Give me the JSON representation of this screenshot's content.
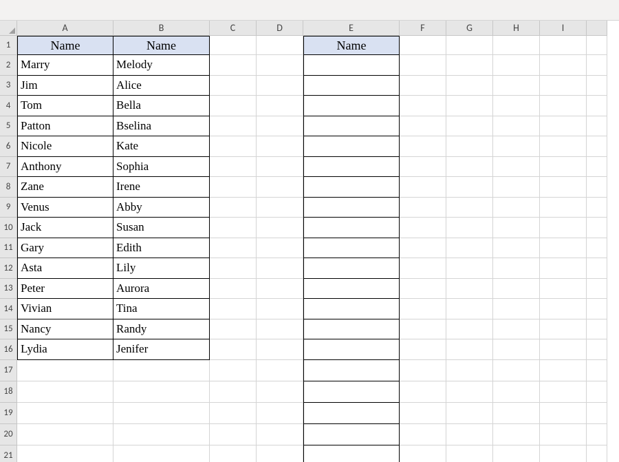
{
  "columns": [
    "A",
    "B",
    "C",
    "D",
    "E",
    "F",
    "G",
    "H",
    "I"
  ],
  "rows": [
    "1",
    "2",
    "3",
    "4",
    "5",
    "6",
    "7",
    "8",
    "9",
    "10",
    "11",
    "12",
    "13",
    "14",
    "15",
    "16",
    "17",
    "18",
    "19",
    "20",
    "21"
  ],
  "headers": {
    "a1": "Name",
    "b1": "Name",
    "e1": "Name"
  },
  "data": {
    "columnA": [
      "Marry",
      "Jim",
      "Tom",
      "Patton",
      "Nicole",
      "Anthony",
      "Zane",
      "Venus",
      "Jack",
      "Gary",
      "Asta",
      "Peter",
      "Vivian",
      "Nancy",
      "Lydia"
    ],
    "columnB": [
      "Melody",
      "Alice",
      "Bella",
      "Bselina",
      "Kate",
      "Sophia",
      "Irene",
      "Abby",
      "Susan",
      "Edith",
      "Lily",
      "Aurora",
      "Tina",
      "Randy",
      "Jenifer"
    ],
    "columnE": [
      "",
      "",
      "",
      "",
      "",
      "",
      "",
      "",
      "",
      "",
      "",
      "",
      "",
      "",
      "",
      "",
      "",
      "",
      "",
      ""
    ]
  }
}
